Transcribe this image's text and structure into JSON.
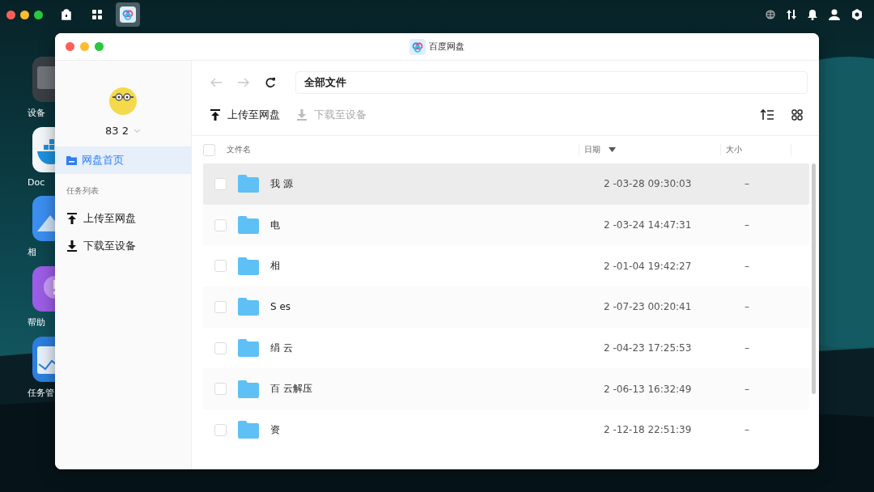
{
  "menu_bar": {
    "apps": [
      {
        "kind": "store",
        "selected": false
      },
      {
        "kind": "grid",
        "selected": false
      },
      {
        "kind": "cloud",
        "selected": true
      }
    ]
  },
  "desktop": {
    "icons": [
      {
        "kind": "monitor",
        "label": "设备"
      },
      {
        "kind": "docker",
        "label": "Doc"
      },
      {
        "kind": "photos",
        "label": "相"
      },
      {
        "kind": "help",
        "label": "帮助"
      },
      {
        "kind": "tasks",
        "label": "任务管"
      }
    ]
  },
  "window": {
    "title": "百度网盘",
    "sidebar": {
      "user": "83 2",
      "items": [
        {
          "label": "网盘首页",
          "selected": true
        }
      ],
      "section": "任务列表",
      "tasks": [
        {
          "label": "上传至网盘",
          "kind": "upload",
          "selected": false
        },
        {
          "label": "下载至设备",
          "kind": "download",
          "selected": false
        }
      ]
    },
    "nav": {
      "back_disabled": true,
      "forward_disabled": true,
      "path": "全部文件"
    },
    "toolbar": [
      {
        "label": "上传至网盘",
        "kind": "upload",
        "disabled": false
      },
      {
        "label": "下载至设备",
        "kind": "download",
        "disabled": true
      }
    ],
    "table": {
      "select_all_checked": false,
      "columns": [
        {
          "label": "文件名",
          "sorted": false
        },
        {
          "label": "日期",
          "sorted": true
        },
        {
          "label": "大小",
          "sorted": false
        }
      ],
      "rows": [
        {
          "name": "我 源",
          "date": "2 -03-28 09:30:03",
          "size": "–",
          "hovered": true,
          "checked": false
        },
        {
          "name": "电",
          "date": "2 -03-24 14:47:31",
          "size": "–",
          "hovered": false,
          "checked": false
        },
        {
          "name": "相",
          "date": "2 -01-04 19:42:27",
          "size": "–",
          "hovered": false,
          "checked": false
        },
        {
          "name": "S es",
          "date": "2 -07-23 00:20:41",
          "size": "–",
          "hovered": false,
          "checked": false
        },
        {
          "name": "绢 云",
          "date": "2 -04-23 17:25:53",
          "size": "–",
          "hovered": false,
          "checked": false
        },
        {
          "name": "百 云解压",
          "date": "2 -06-13 16:32:49",
          "size": "–",
          "hovered": false,
          "checked": false
        },
        {
          "name": "资",
          "date": "2 -12-18 22:51:39",
          "size": "–",
          "hovered": false,
          "checked": false
        }
      ]
    }
  }
}
